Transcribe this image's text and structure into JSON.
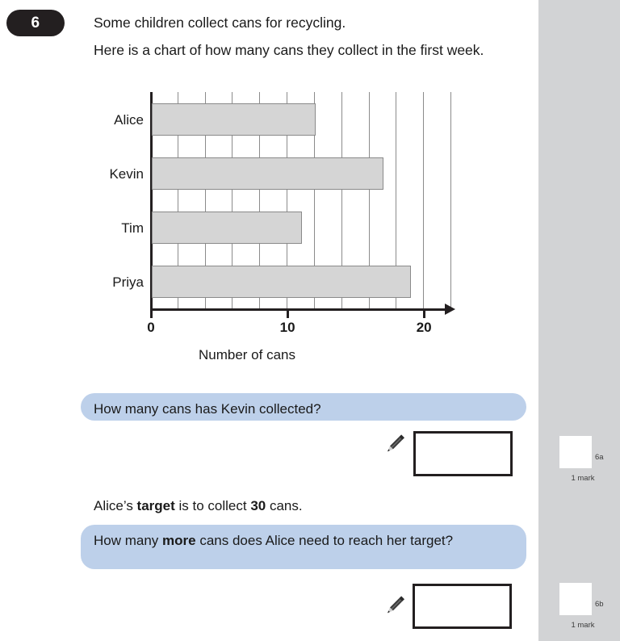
{
  "question_number": "6",
  "intro": {
    "line1": "Some children collect cans for recycling.",
    "line2": "Here is a chart of how many cans they collect in the first week."
  },
  "chart_data": {
    "type": "bar",
    "orientation": "horizontal",
    "title": "",
    "categories": [
      "Alice",
      "Kevin",
      "Tim",
      "Priya"
    ],
    "values": [
      12,
      17,
      11,
      19
    ],
    "xlabel": "Number of cans",
    "ylabel": "",
    "xlim": [
      0,
      22
    ],
    "xticks": [
      0,
      10,
      20
    ],
    "xtick_labels": [
      "0",
      "10",
      "20"
    ],
    "gridline_interval": 2,
    "grid": true,
    "legend": "none",
    "bar_fill_color": "#d5d5d5",
    "bar_border_color": "#8a8a8a"
  },
  "part_a": {
    "question": "How many cans has Kevin collected?",
    "answer_value": "",
    "pencil_icon": "pencil-icon"
  },
  "statement": {
    "prefix": "Alice’s ",
    "bold1": "target",
    "middle": " is to collect ",
    "bold2": "30",
    "suffix": " cans."
  },
  "part_b": {
    "question_prefix": "How many ",
    "question_bold": "more",
    "question_suffix": " cans does Alice need to reach her target?",
    "answer_value": "",
    "pencil_icon": "pencil-icon"
  },
  "marks": [
    {
      "id": "6a",
      "text": "1 mark"
    },
    {
      "id": "6b",
      "text": "1 mark"
    }
  ],
  "colors": {
    "banner": "#bdd0ea",
    "badge": "#231f20",
    "sidebar": "#d2d3d5",
    "bar": "#d5d5d5"
  }
}
